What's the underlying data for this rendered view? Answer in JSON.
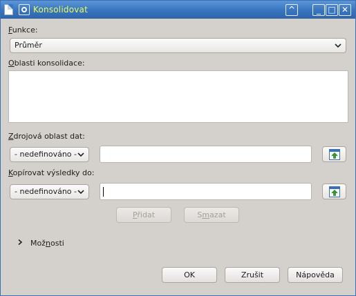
{
  "window": {
    "title": "Konsolidovat",
    "shade_glyph": "^",
    "minimize_glyph": "_",
    "maximize_glyph": "□",
    "close_glyph": "✕"
  },
  "function": {
    "label_first": "F",
    "label_rest": "unkce:",
    "value": "Průměr"
  },
  "areas": {
    "label_first": "O",
    "label_rest": "blasti konsolidace:"
  },
  "source": {
    "label_first": "Z",
    "label_rest": "drojová oblast dat:",
    "selected": "- nedefinováno -",
    "value": ""
  },
  "copy": {
    "label_first": "K",
    "label_rest": "opírovat výsledky do:",
    "selected": "- nedefinováno -",
    "value": ""
  },
  "actions": {
    "add_first": "P",
    "add_rest": "řidat",
    "delete_first": "S",
    "delete_mid": "m",
    "delete_rest": "azat"
  },
  "options": {
    "label_a": "Mož",
    "label_b": "n",
    "label_c": "osti"
  },
  "footer": {
    "ok": "OK",
    "cancel": "Zrušit",
    "help": "Nápověda"
  },
  "icons": {
    "shrink": "shrink-range-icon",
    "expand": "expander-arrow-icon"
  }
}
